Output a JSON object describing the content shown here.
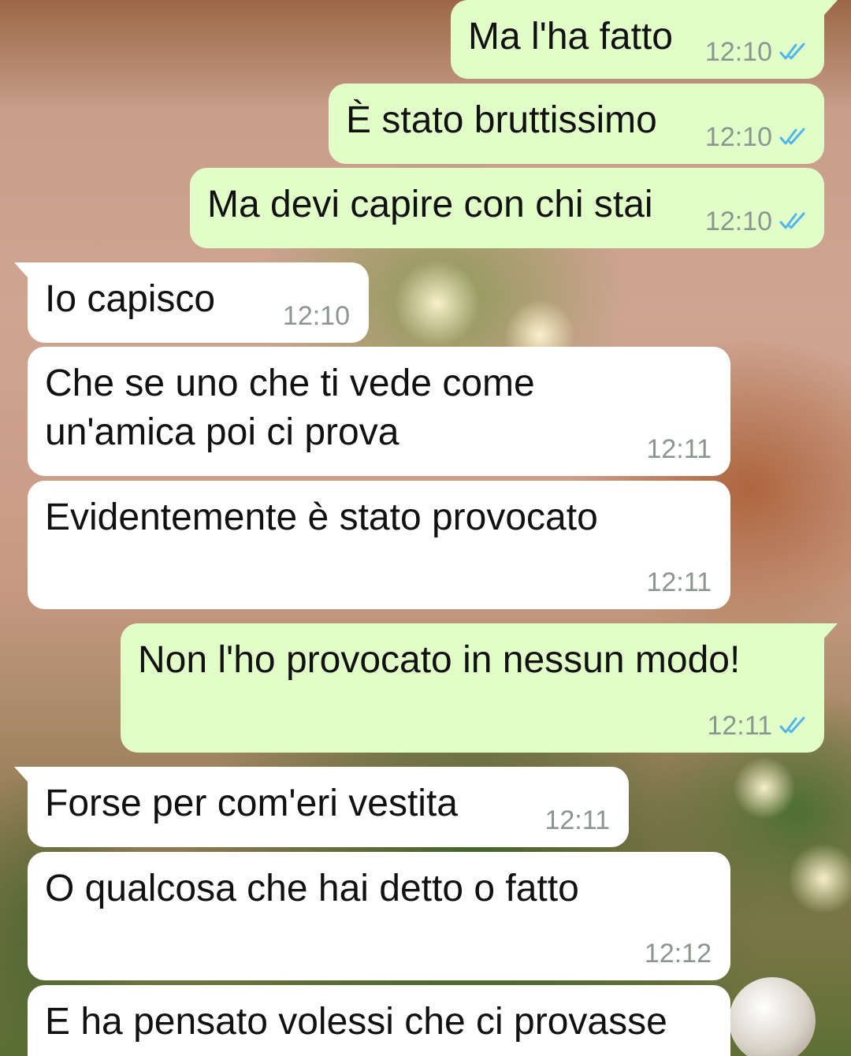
{
  "colors": {
    "outgoing_bubble": "#e2fec8",
    "incoming_bubble": "#ffffff",
    "read_ticks": "#4fb6ec",
    "timestamp": "#8b968e"
  },
  "icons": {
    "read_receipt": "double-check-icon"
  },
  "messages": [
    {
      "direction": "out",
      "text": "Ma l'ha fatto",
      "time": "12:10",
      "status": "read"
    },
    {
      "direction": "out",
      "text": "È stato bruttissimo",
      "time": "12:10",
      "status": "read"
    },
    {
      "direction": "out",
      "text": "Ma devi capire con chi stai",
      "time": "12:10",
      "status": "read"
    },
    {
      "direction": "in",
      "text": "Io capisco",
      "time": "12:10"
    },
    {
      "direction": "in",
      "text": "Che se uno che ti vede come\nun'amica poi ci prova",
      "time": "12:11"
    },
    {
      "direction": "in",
      "text": "Evidentemente è stato provocato",
      "time": "12:11"
    },
    {
      "direction": "out",
      "text": "Non l'ho provocato in nessun modo!",
      "time": "12:11",
      "status": "read"
    },
    {
      "direction": "in",
      "text": "Forse per com'eri vestita",
      "time": "12:11"
    },
    {
      "direction": "in",
      "text": "O qualcosa che hai detto o fatto",
      "time": "12:12"
    },
    {
      "direction": "in",
      "text": "E ha pensato volessi che ci provasse",
      "time": ""
    }
  ]
}
